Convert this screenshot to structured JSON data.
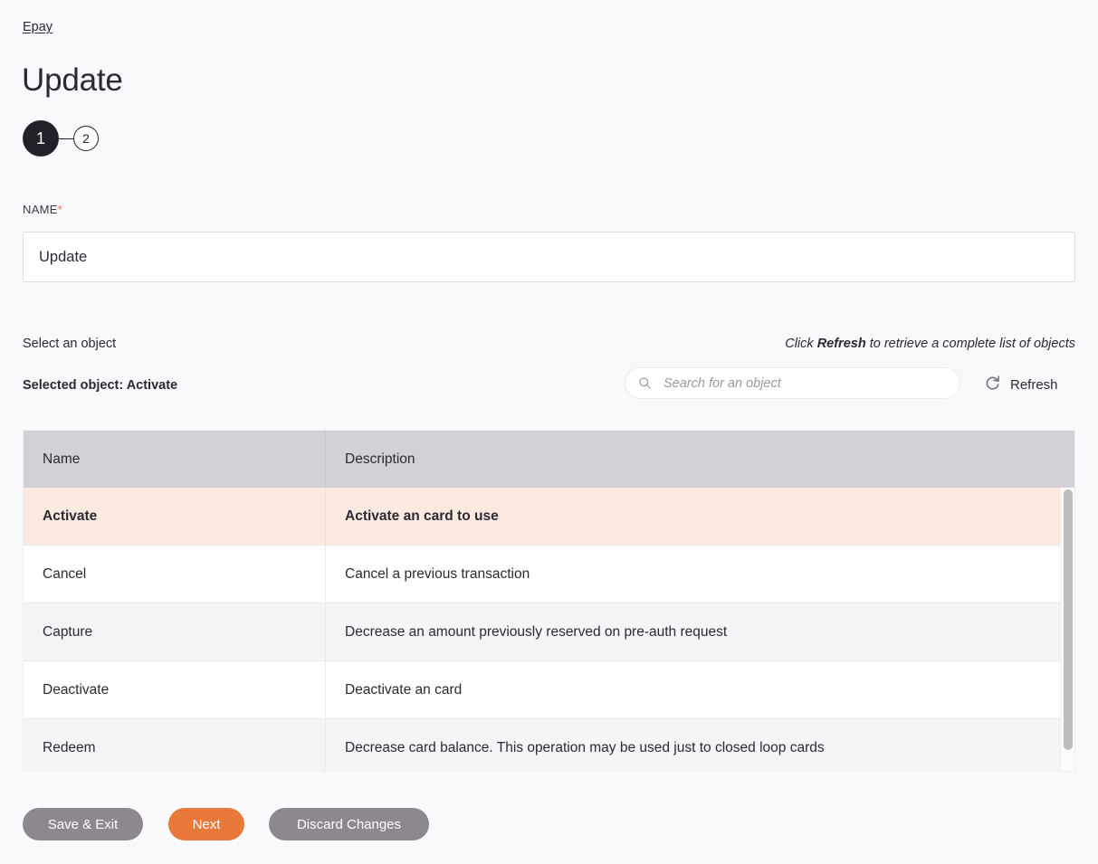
{
  "breadcrumb": {
    "label": "Epay"
  },
  "page": {
    "title": "Update"
  },
  "stepper": {
    "steps": [
      {
        "label": "1",
        "state": "active"
      },
      {
        "label": "2",
        "state": "inactive"
      }
    ]
  },
  "name_field": {
    "label": "NAME",
    "required_marker": "*",
    "value": "Update",
    "placeholder": ""
  },
  "object_section": {
    "select_label": "Select an object",
    "hint_prefix": "Click ",
    "hint_bold": "Refresh",
    "hint_suffix": " to retrieve a complete list of objects",
    "selected_object": "Selected object: Activate",
    "search_placeholder": "Search for an object",
    "search_value": "",
    "refresh_label": "Refresh"
  },
  "table": {
    "columns": [
      "Name",
      "Description"
    ],
    "rows": [
      {
        "name": "Activate",
        "description": "Activate an card to use",
        "selected": true
      },
      {
        "name": "Cancel",
        "description": "Cancel a previous transaction",
        "selected": false
      },
      {
        "name": "Capture",
        "description": "Decrease an amount previously reserved on pre-auth request",
        "selected": false
      },
      {
        "name": "Deactivate",
        "description": "Deactivate an card",
        "selected": false
      },
      {
        "name": "Redeem",
        "description": "Decrease card balance. This operation may be used just to closed loop cards",
        "selected": false
      }
    ]
  },
  "footer": {
    "save_label": "Save & Exit",
    "next_label": "Next",
    "discard_label": "Discard Changes"
  },
  "colors": {
    "accent_orange": "#e8793a",
    "selected_row": "#fceae0",
    "header_bg": "#d3d0d7",
    "button_gray": "#8d8790",
    "step_dark": "#22212a",
    "page_bg": "#f9f9fb"
  }
}
